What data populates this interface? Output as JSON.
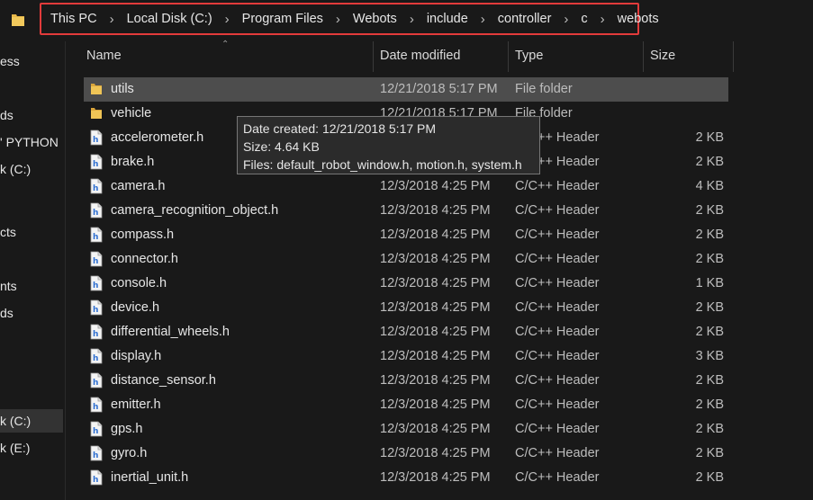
{
  "address": {
    "segments": [
      "This PC",
      "Local Disk (C:)",
      "Program Files",
      "Webots",
      "include",
      "controller",
      "c",
      "webots"
    ]
  },
  "nav": {
    "items": [
      {
        "label": "ess",
        "selected": false
      },
      {
        "label": "ds",
        "selected": false
      },
      {
        "label": "' PYTHON",
        "selected": false
      },
      {
        "label": "k (C:)",
        "selected": false
      },
      {
        "label": "cts",
        "selected": false
      },
      {
        "label": "nts",
        "selected": false
      },
      {
        "label": "ds",
        "selected": false
      },
      {
        "label": "k (C:)",
        "selected": true
      },
      {
        "label": "k (E:)",
        "selected": false
      }
    ]
  },
  "columns": {
    "name": "Name",
    "date": "Date modified",
    "type": "Type",
    "size": "Size"
  },
  "files": [
    {
      "name": "utils",
      "date": "12/21/2018 5:17 PM",
      "type": "File folder",
      "size": "",
      "icon": "folder-icon",
      "hover": true
    },
    {
      "name": "vehicle",
      "date": "12/21/2018 5:17 PM",
      "type": "File folder",
      "size": "",
      "icon": "folder-icon",
      "hover": false
    },
    {
      "name": "accelerometer.h",
      "date": "12/3/2018 4:25 PM",
      "type": "C/C++ Header",
      "size": "2 KB",
      "icon": "header-file-icon",
      "hover": false
    },
    {
      "name": "brake.h",
      "date": "12/3/2018 4:25 PM",
      "type": "C/C++ Header",
      "size": "2 KB",
      "icon": "header-file-icon",
      "hover": false
    },
    {
      "name": "camera.h",
      "date": "12/3/2018 4:25 PM",
      "type": "C/C++ Header",
      "size": "4 KB",
      "icon": "header-file-icon",
      "hover": false
    },
    {
      "name": "camera_recognition_object.h",
      "date": "12/3/2018 4:25 PM",
      "type": "C/C++ Header",
      "size": "2 KB",
      "icon": "header-file-icon",
      "hover": false
    },
    {
      "name": "compass.h",
      "date": "12/3/2018 4:25 PM",
      "type": "C/C++ Header",
      "size": "2 KB",
      "icon": "header-file-icon",
      "hover": false
    },
    {
      "name": "connector.h",
      "date": "12/3/2018 4:25 PM",
      "type": "C/C++ Header",
      "size": "2 KB",
      "icon": "header-file-icon",
      "hover": false
    },
    {
      "name": "console.h",
      "date": "12/3/2018 4:25 PM",
      "type": "C/C++ Header",
      "size": "1 KB",
      "icon": "header-file-icon",
      "hover": false
    },
    {
      "name": "device.h",
      "date": "12/3/2018 4:25 PM",
      "type": "C/C++ Header",
      "size": "2 KB",
      "icon": "header-file-icon",
      "hover": false
    },
    {
      "name": "differential_wheels.h",
      "date": "12/3/2018 4:25 PM",
      "type": "C/C++ Header",
      "size": "2 KB",
      "icon": "header-file-icon",
      "hover": false
    },
    {
      "name": "display.h",
      "date": "12/3/2018 4:25 PM",
      "type": "C/C++ Header",
      "size": "3 KB",
      "icon": "header-file-icon",
      "hover": false
    },
    {
      "name": "distance_sensor.h",
      "date": "12/3/2018 4:25 PM",
      "type": "C/C++ Header",
      "size": "2 KB",
      "icon": "header-file-icon",
      "hover": false
    },
    {
      "name": "emitter.h",
      "date": "12/3/2018 4:25 PM",
      "type": "C/C++ Header",
      "size": "2 KB",
      "icon": "header-file-icon",
      "hover": false
    },
    {
      "name": "gps.h",
      "date": "12/3/2018 4:25 PM",
      "type": "C/C++ Header",
      "size": "2 KB",
      "icon": "header-file-icon",
      "hover": false
    },
    {
      "name": "gyro.h",
      "date": "12/3/2018 4:25 PM",
      "type": "C/C++ Header",
      "size": "2 KB",
      "icon": "header-file-icon",
      "hover": false
    },
    {
      "name": "inertial_unit.h",
      "date": "12/3/2018 4:25 PM",
      "type": "C/C++ Header",
      "size": "2 KB",
      "icon": "header-file-icon",
      "hover": false
    }
  ],
  "tooltip": {
    "line1": "Date created: 12/21/2018 5:17 PM",
    "line2": "Size: 4.64 KB",
    "line3": "Files: default_robot_window.h, motion.h, system.h"
  },
  "colors": {
    "background": "#191919",
    "hover_row": "#4d4d4d",
    "highlight_border": "#e23b3b",
    "folder": "#e8b84a",
    "header_icon": "#3a78d6"
  }
}
